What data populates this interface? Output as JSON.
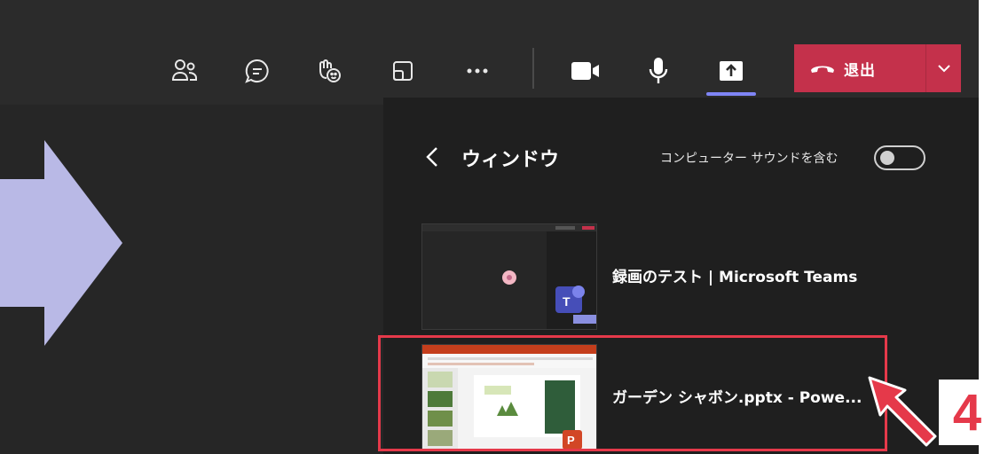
{
  "toolbar": {
    "icons": [
      "people-icon",
      "chat-icon",
      "raise-hand-icon",
      "breakout-rooms-icon",
      "more-icon",
      "camera-icon",
      "microphone-icon",
      "share-screen-icon"
    ],
    "leave_label": "退出",
    "accent": "#c4314b",
    "share_indicator": "#7f85f5"
  },
  "share_panel": {
    "title": "ウィンドウ",
    "sound_label": "コンピューター サウンドを含む",
    "sound_toggle": "off",
    "windows": [
      {
        "title": "録画のテスト | Microsoft Teams",
        "app": "Microsoft Teams"
      },
      {
        "title": "ガーデン シャボン.pptx - Powe...",
        "app": "PowerPoint"
      }
    ]
  },
  "annotation": {
    "step_number": "4",
    "color": "#e5394a",
    "pointer_color": "#b9b9e6"
  }
}
